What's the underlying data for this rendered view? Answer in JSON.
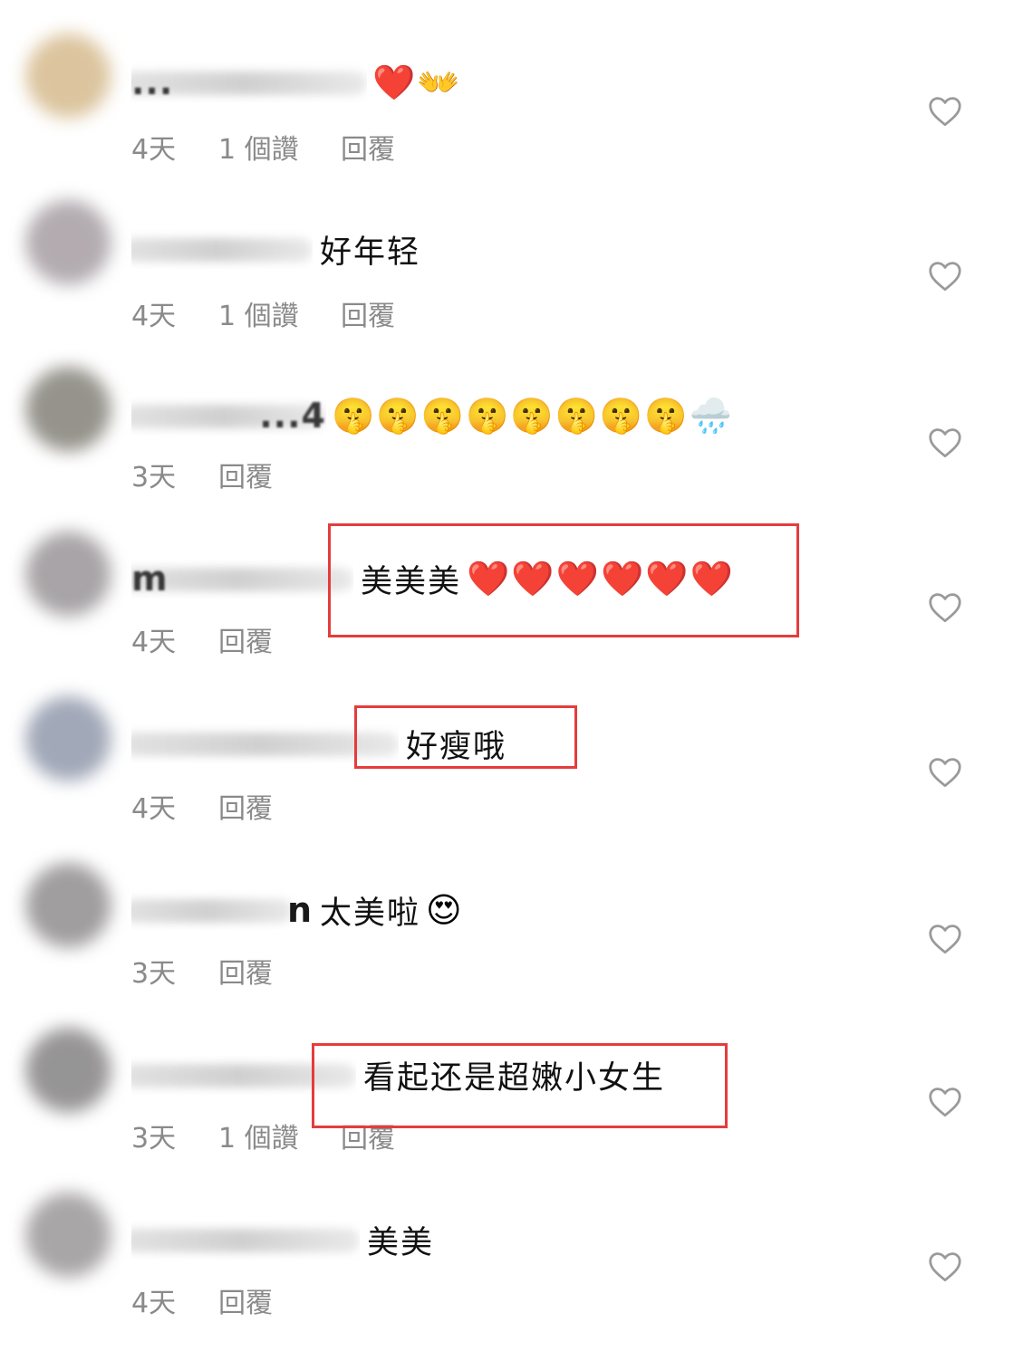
{
  "comments": [
    {
      "username": "...",
      "text": "",
      "emojis": "❤️👐",
      "age": "4天",
      "likes": "1 個讚",
      "reply": "回覆",
      "avatar_color": "#c9a66b"
    },
    {
      "username": "",
      "text": "好年轻",
      "emojis": "",
      "age": "4天",
      "likes": "1 個讚",
      "reply": "回覆",
      "avatar_color": "#8a7f86"
    },
    {
      "username": "...4",
      "text": "",
      "emojis": "🤫🤫🤫🤫🤫🤫🤫🤫🌧️",
      "age": "3天",
      "likes": "",
      "reply": "回覆",
      "avatar_color": "#5e5a4f"
    },
    {
      "username": "m",
      "text": "美美美",
      "emojis": "❤️❤️❤️❤️❤️❤️",
      "age": "4天",
      "likes": "",
      "reply": "回覆",
      "avatar_color": "#7a7478"
    },
    {
      "username": "",
      "text": "好瘦哦",
      "emojis": "",
      "age": "4天",
      "likes": "",
      "reply": "回覆",
      "avatar_color": "#6f7a92"
    },
    {
      "username": "n",
      "text": "太美啦",
      "emojis": "😍",
      "age": "3天",
      "likes": "",
      "reply": "回覆",
      "avatar_color": "#6e6a6c"
    },
    {
      "username": "",
      "text": "看起还是超嫩小女生",
      "emojis": "",
      "age": "3天",
      "likes": "1 個讚",
      "reply": "回覆",
      "avatar_color": "#5f5c5e"
    },
    {
      "username": "",
      "text": "美美",
      "emojis": "",
      "age": "4天",
      "likes": "",
      "reply": "回覆",
      "avatar_color": "#7c777a"
    }
  ],
  "colors": {
    "highlight": "#e53c3c",
    "meta": "#8a8a8a",
    "icon": "#9a9a9a"
  },
  "icons": {
    "like": "heart-outline-icon"
  }
}
